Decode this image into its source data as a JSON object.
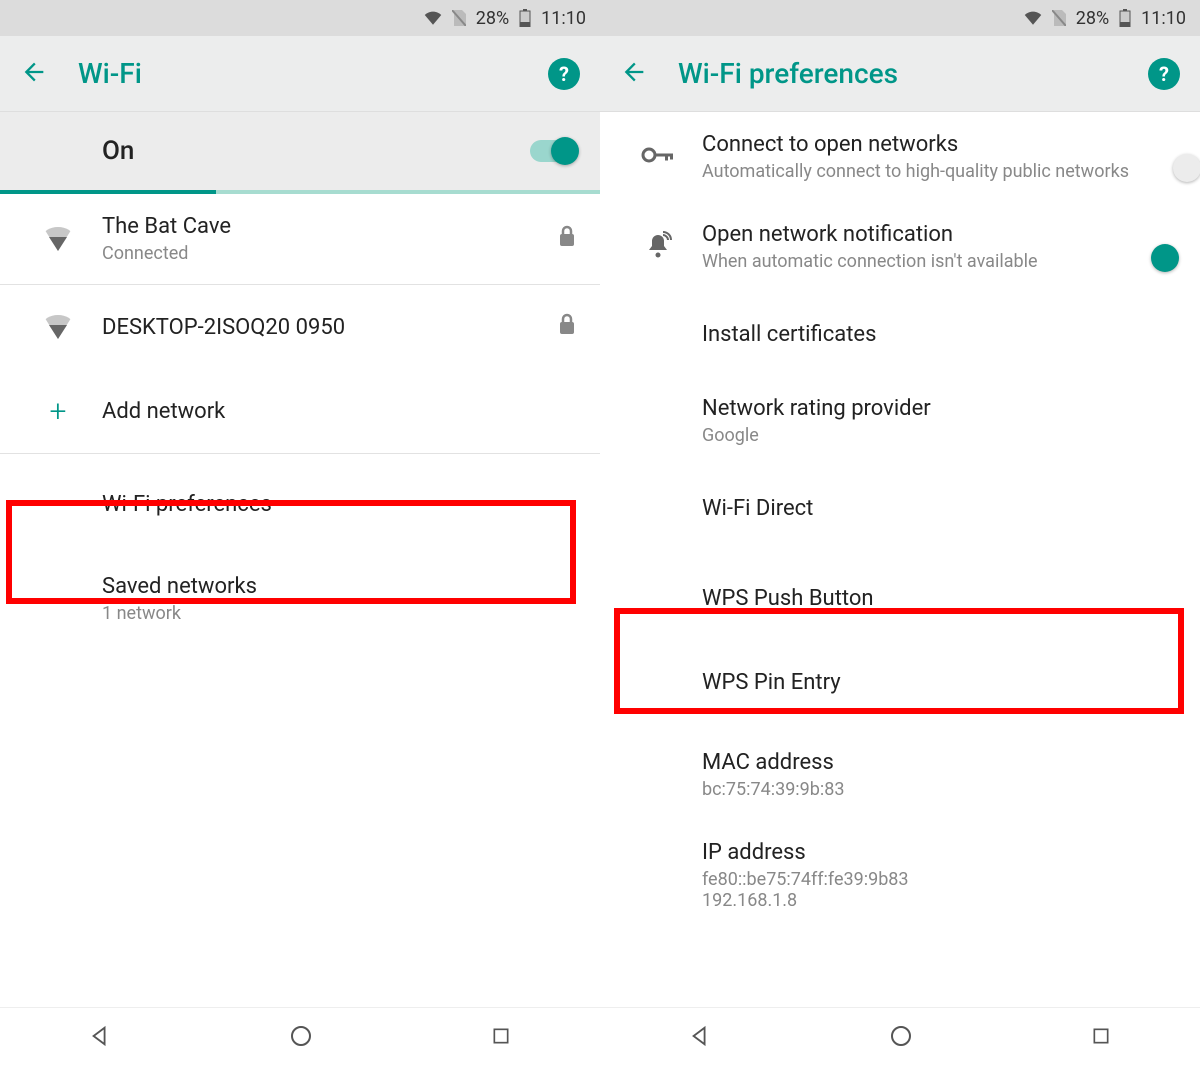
{
  "status": {
    "battery_pct": "28%",
    "time": "11:10"
  },
  "left": {
    "title": "Wi-Fi",
    "on_label": "On",
    "networks": [
      {
        "ssid": "The Bat Cave",
        "sub": "Connected",
        "secured": true
      },
      {
        "ssid": "DESKTOP-2ISOQ20 0950",
        "sub": "",
        "secured": true
      }
    ],
    "add_label": "Add network",
    "prefs_label": "Wi-Fi preferences",
    "saved_label": "Saved networks",
    "saved_sub": "1 network"
  },
  "right": {
    "title": "Wi-Fi preferences",
    "items": {
      "open_title": "Connect to open networks",
      "open_sub": "Automatically connect to high-quality public networks",
      "notify_title": "Open network notification",
      "notify_sub": "When automatic connection isn't available",
      "install_cert": "Install certificates",
      "rating_title": "Network rating provider",
      "rating_sub": "Google",
      "wifi_direct": "Wi-Fi Direct",
      "wps_push": "WPS Push Button",
      "wps_pin": "WPS Pin Entry",
      "mac_title": "MAC address",
      "mac_value": "bc:75:74:39:9b:83",
      "ip_title": "IP address",
      "ip_value1": "fe80::be75:74ff:fe39:9b83",
      "ip_value2": "192.168.1.8"
    }
  }
}
